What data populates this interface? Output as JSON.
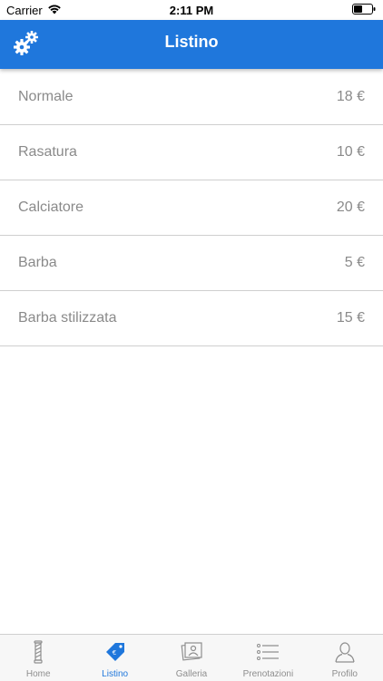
{
  "status_bar": {
    "carrier": "Carrier",
    "time": "2:11 PM"
  },
  "nav": {
    "title": "Listino",
    "settings_icon": "gears-icon"
  },
  "items": [
    {
      "name": "Normale",
      "price": "18 €"
    },
    {
      "name": "Rasatura",
      "price": "10 €"
    },
    {
      "name": "Calciatore",
      "price": "20 €"
    },
    {
      "name": "Barba",
      "price": "5 €"
    },
    {
      "name": "Barba stilizzata",
      "price": "15 €"
    }
  ],
  "tabs": [
    {
      "label": "Home",
      "icon": "barber-pole-icon"
    },
    {
      "label": "Listino",
      "icon": "price-tag-icon",
      "active": true
    },
    {
      "label": "Galleria",
      "icon": "photos-icon"
    },
    {
      "label": "Prenotazioni",
      "icon": "list-icon"
    },
    {
      "label": "Profilo",
      "icon": "user-icon"
    }
  ],
  "colors": {
    "accent": "#1f77dc",
    "text_muted": "#8a8a8a",
    "tab_inactive": "#8e8e8e"
  }
}
